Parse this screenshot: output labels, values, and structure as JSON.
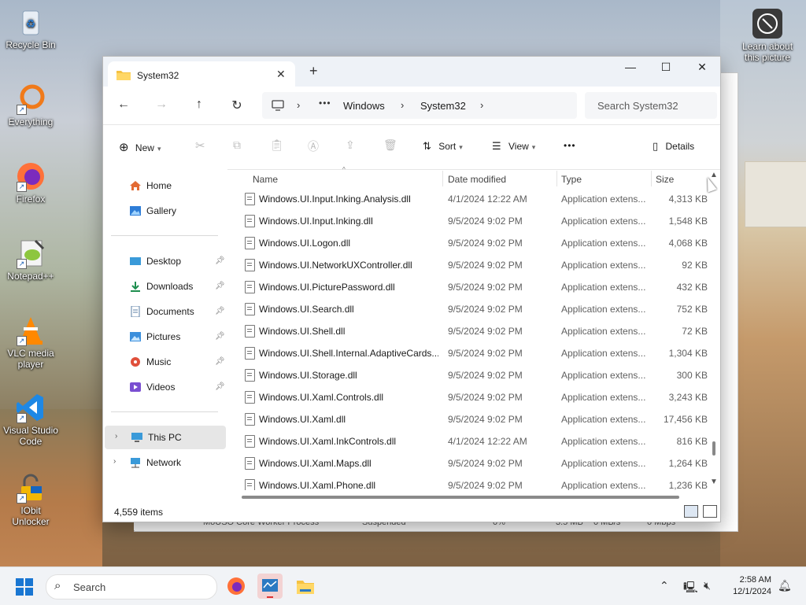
{
  "desktop": {
    "icons": [
      {
        "label": "Recycle Bin"
      },
      {
        "label": "Everything"
      },
      {
        "label": "Firefox"
      },
      {
        "label": "Notepad++"
      },
      {
        "label": "VLC media player"
      },
      {
        "label": "Visual Studio Code"
      },
      {
        "label": "IObit Unlocker"
      }
    ],
    "right_icon": {
      "label": "Learn about this picture"
    }
  },
  "background_window": {
    "row": {
      "name": "MoUSO Core Worker Process",
      "status": "Suspended",
      "cpu": "0%",
      "memory": "3.5 MB",
      "disk": "0 MB/s",
      "network": "0 Mbps"
    }
  },
  "explorer": {
    "tab_title": "System32",
    "breadcrumb": [
      "Windows",
      "System32"
    ],
    "search_placeholder": "Search System32",
    "toolbar": {
      "new_label": "New",
      "sort_label": "Sort",
      "view_label": "View",
      "details_label": "Details",
      "more_label": "•••"
    },
    "nav": {
      "home": "Home",
      "gallery": "Gallery",
      "desktop": "Desktop",
      "downloads": "Downloads",
      "documents": "Documents",
      "pictures": "Pictures",
      "music": "Music",
      "videos": "Videos",
      "this_pc": "This PC",
      "network": "Network"
    },
    "columns": {
      "name": "Name",
      "date": "Date modified",
      "type": "Type",
      "size": "Size"
    },
    "rows": [
      {
        "name": "Windows.UI.Input.Inking.Analysis.dll",
        "date": "4/1/2024 12:22 AM",
        "type": "Application extens...",
        "size": "4,313 KB"
      },
      {
        "name": "Windows.UI.Input.Inking.dll",
        "date": "9/5/2024 9:02 PM",
        "type": "Application extens...",
        "size": "1,548 KB"
      },
      {
        "name": "Windows.UI.Logon.dll",
        "date": "9/5/2024 9:02 PM",
        "type": "Application extens...",
        "size": "4,068 KB"
      },
      {
        "name": "Windows.UI.NetworkUXController.dll",
        "date": "9/5/2024 9:02 PM",
        "type": "Application extens...",
        "size": "92 KB"
      },
      {
        "name": "Windows.UI.PicturePassword.dll",
        "date": "9/5/2024 9:02 PM",
        "type": "Application extens...",
        "size": "432 KB"
      },
      {
        "name": "Windows.UI.Search.dll",
        "date": "9/5/2024 9:02 PM",
        "type": "Application extens...",
        "size": "752 KB"
      },
      {
        "name": "Windows.UI.Shell.dll",
        "date": "9/5/2024 9:02 PM",
        "type": "Application extens...",
        "size": "72 KB"
      },
      {
        "name": "Windows.UI.Shell.Internal.AdaptiveCards....",
        "date": "9/5/2024 9:02 PM",
        "type": "Application extens...",
        "size": "1,304 KB"
      },
      {
        "name": "Windows.UI.Storage.dll",
        "date": "9/5/2024 9:02 PM",
        "type": "Application extens...",
        "size": "300 KB"
      },
      {
        "name": "Windows.UI.Xaml.Controls.dll",
        "date": "9/5/2024 9:02 PM",
        "type": "Application extens...",
        "size": "3,243 KB"
      },
      {
        "name": "Windows.UI.Xaml.dll",
        "date": "9/5/2024 9:02 PM",
        "type": "Application extens...",
        "size": "17,456 KB"
      },
      {
        "name": "Windows.UI.Xaml.InkControls.dll",
        "date": "4/1/2024 12:22 AM",
        "type": "Application extens...",
        "size": "816 KB"
      },
      {
        "name": "Windows.UI.Xaml.Maps.dll",
        "date": "9/5/2024 9:02 PM",
        "type": "Application extens...",
        "size": "1,264 KB"
      },
      {
        "name": "Windows.UI.Xaml.Phone.dll",
        "date": "9/5/2024 9:02 PM",
        "type": "Application extens...",
        "size": "1,236 KB"
      }
    ],
    "status_count": "4,559 items"
  },
  "taskbar": {
    "search_placeholder": "Search",
    "time": "2:58 AM",
    "date": "12/1/2024"
  },
  "colors": {
    "accent": "#1976d2",
    "folder": "#f5c242"
  }
}
